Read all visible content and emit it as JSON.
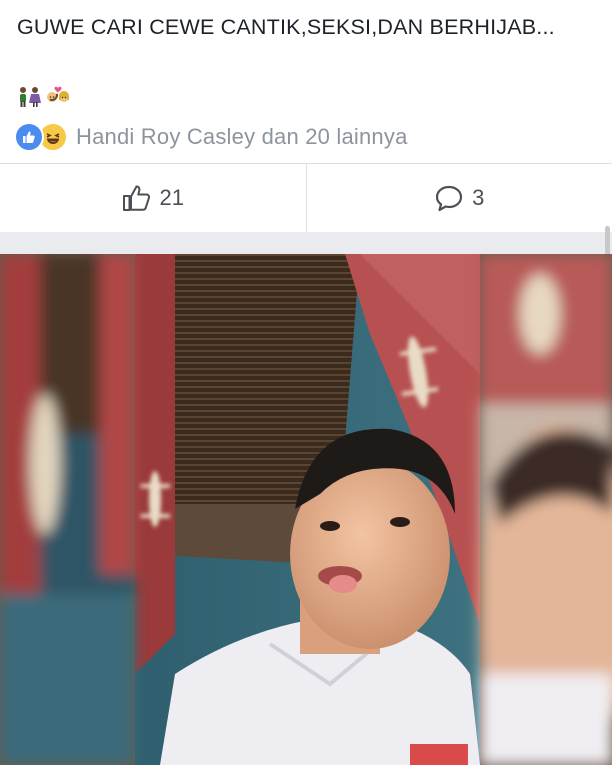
{
  "post": {
    "caption": "GUWE CARI CEWE CANTIK,SEKSI,DAN BERHIJAB...",
    "emojis": [
      "couple-icon",
      "couple-with-heart-icon"
    ],
    "reactions": {
      "types": [
        "like-reaction-icon",
        "haha-reaction-icon"
      ],
      "summary": "Handi Roy Casley dan 20 lainnya"
    },
    "actions": {
      "like_count": "21",
      "comment_count": "3"
    }
  },
  "colors": {
    "like_blue": "#4a8cf0",
    "haha_yellow": "#f7c948",
    "muted_text": "#8d949e",
    "separator": "#dddfe2",
    "feed_gap": "#e9ebee"
  }
}
